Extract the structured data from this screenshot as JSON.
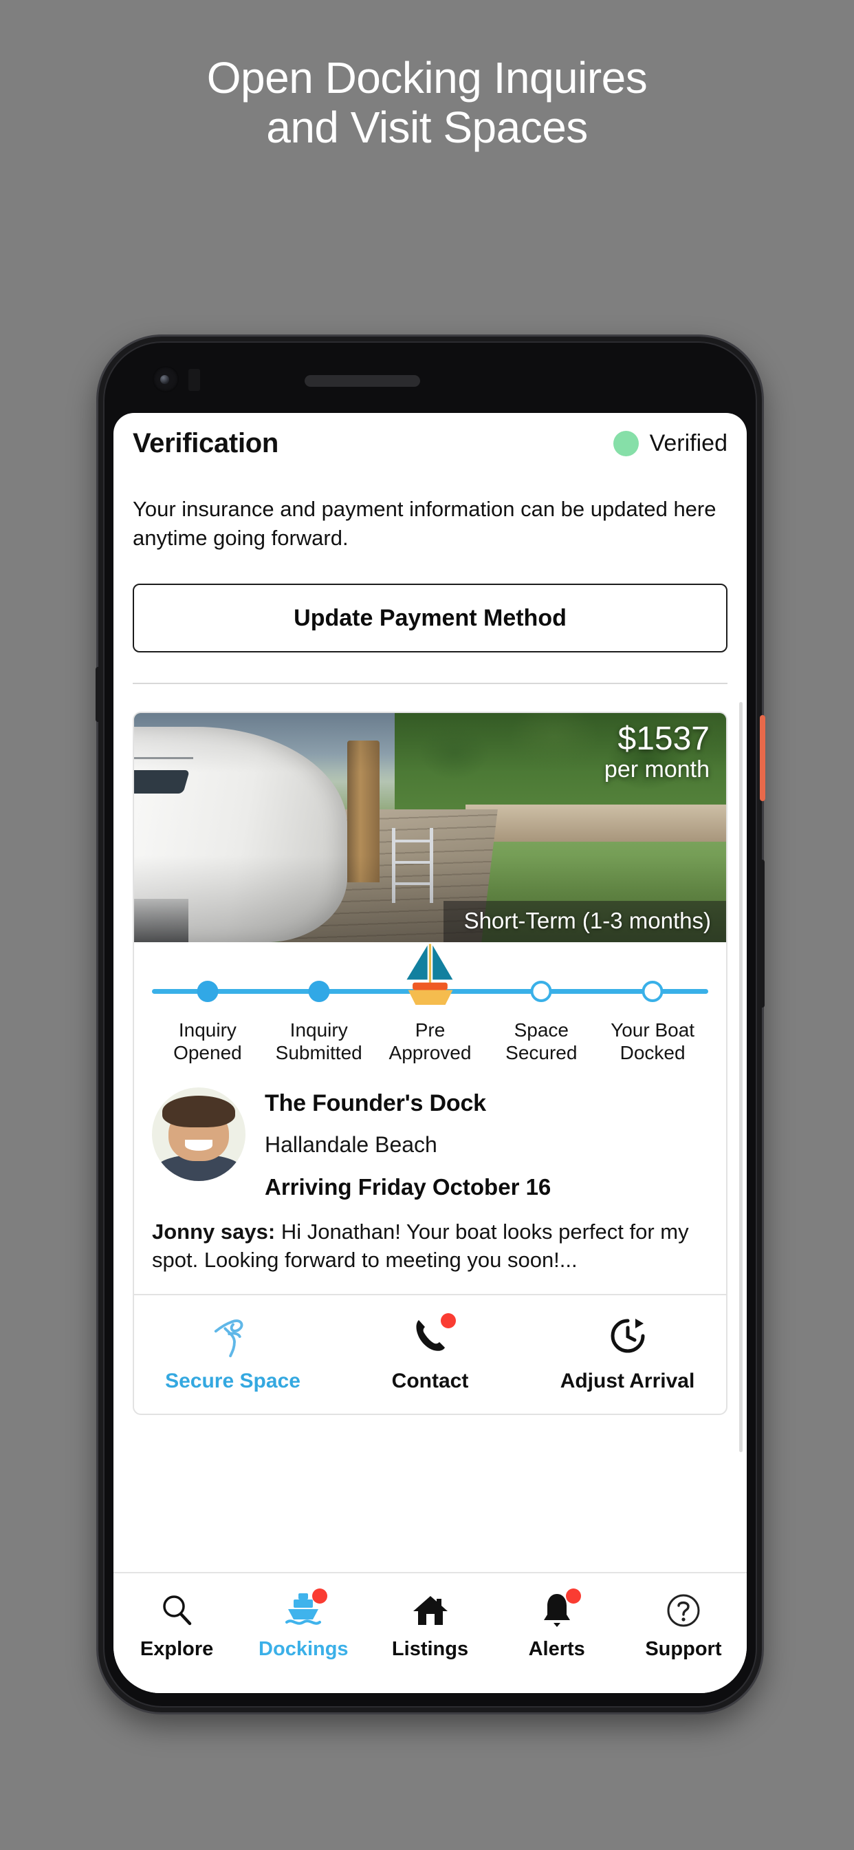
{
  "promo": {
    "headline_line1": "Open Docking Inquires",
    "headline_line2": "and Visit Spaces"
  },
  "app": {
    "header": {
      "title": "Verification",
      "status_label": "Verified",
      "status_color": "#86dfa8"
    },
    "intro_text": "Your insurance and payment information can be updated here anytime going forward.",
    "update_payment_label": "Update Payment Method",
    "listing": {
      "price_amount": "$1537",
      "price_period": "per month",
      "term_badge": "Short-Term (1-3 months)",
      "host_name": "The Founder's Dock",
      "location": "Hallandale Beach",
      "arrival": "Arriving Friday October 16",
      "message_author": "Jonny says:",
      "message_body": " Hi Jonathan! Your boat looks perfect for my spot. Looking forward to meeting you soon!..."
    },
    "stepper": {
      "steps": [
        {
          "line1": "Inquiry",
          "line2": "Opened",
          "state": "done"
        },
        {
          "line1": "Inquiry",
          "line2": "Submitted",
          "state": "done"
        },
        {
          "line1": "Pre",
          "line2": "Approved",
          "state": "current"
        },
        {
          "line1": "Space",
          "line2": "Secured",
          "state": "todo"
        },
        {
          "line1": "Your Boat",
          "line2": "Docked",
          "state": "todo"
        }
      ],
      "active_color": "#31a8e6",
      "track_color": "#39b0e8"
    },
    "actions": [
      {
        "label": "Secure Space",
        "icon": "knot-icon",
        "accent": "#34a8e0",
        "badge": false
      },
      {
        "label": "Contact",
        "icon": "phone-icon",
        "accent": "#101010",
        "badge": true
      },
      {
        "label": "Adjust Arrival",
        "icon": "clock-reset-icon",
        "accent": "#101010",
        "badge": false
      }
    ],
    "bottom_nav": [
      {
        "label": "Explore",
        "icon": "search-icon",
        "active": false,
        "badge": false
      },
      {
        "label": "Dockings",
        "icon": "boat-icon",
        "active": true,
        "badge": true
      },
      {
        "label": "Listings",
        "icon": "home-icon",
        "active": false,
        "badge": false
      },
      {
        "label": "Alerts",
        "icon": "bell-icon",
        "active": false,
        "badge": true
      },
      {
        "label": "Support",
        "icon": "question-icon",
        "active": false,
        "badge": false
      }
    ]
  }
}
